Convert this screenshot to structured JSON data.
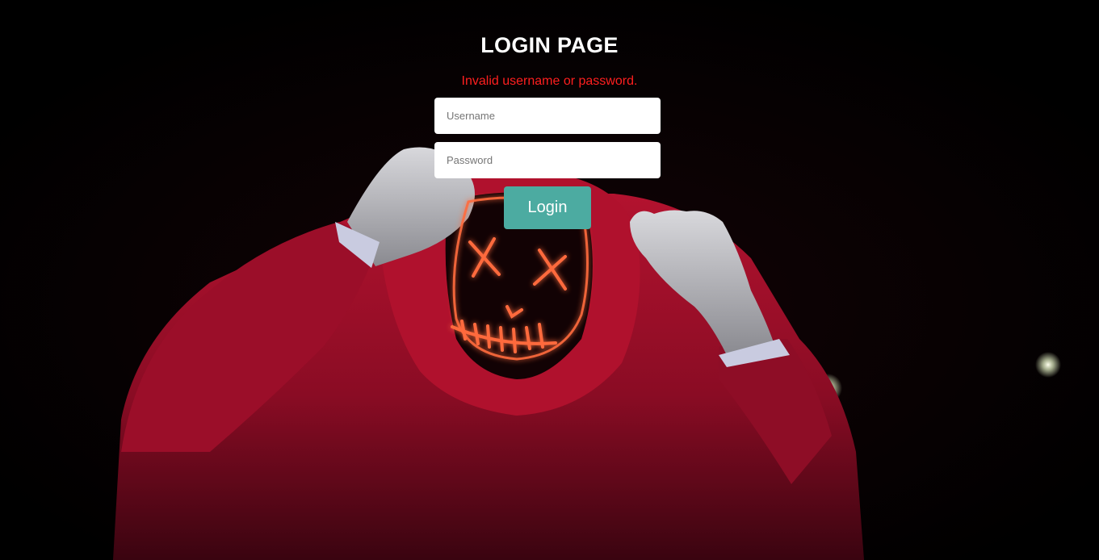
{
  "page": {
    "title": "LOGIN PAGE",
    "error_message": "Invalid username or password."
  },
  "form": {
    "username": {
      "placeholder": "Username",
      "value": ""
    },
    "password": {
      "placeholder": "Password",
      "value": ""
    },
    "submit_label": "Login"
  },
  "colors": {
    "title": "#ffffff",
    "error": "#ff1f1f",
    "button_bg": "#4caba1",
    "button_text": "#ffffff",
    "field_bg": "#ffffff",
    "hoodie_red": "#a8102c",
    "mask_glow": "#ff5a3a"
  },
  "background": {
    "image_subject": "hooded figure with glowing neon mask"
  }
}
